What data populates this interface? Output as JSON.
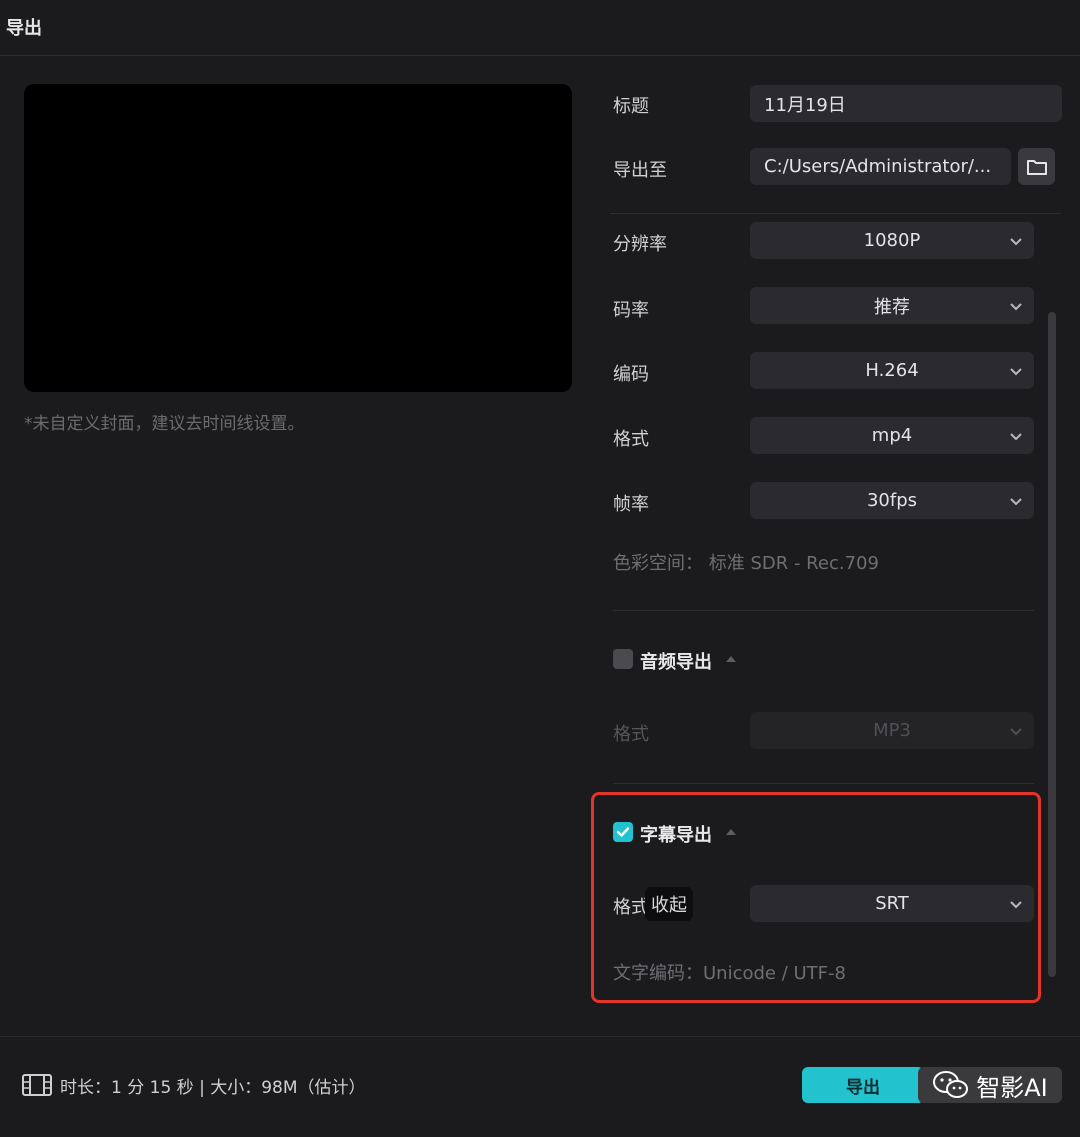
{
  "window": {
    "title": "导出"
  },
  "preview": {
    "note": "*未自定义封面，建议去时间线设置。"
  },
  "form": {
    "title_label": "标题",
    "title_value": "11月19日",
    "export_to_label": "导出至",
    "export_to_value": "C:/Users/Administrator/...",
    "resolution_label": "分辨率",
    "resolution_value": "1080P",
    "bitrate_label": "码率",
    "bitrate_value": "推荐",
    "codec_label": "编码",
    "codec_value": "H.264",
    "format_label": "格式",
    "format_value": "mp4",
    "fps_label": "帧率",
    "fps_value": "30fps",
    "color_space": "色彩空间：  标准 SDR - Rec.709"
  },
  "audio_export": {
    "title": "音频导出",
    "checked": false,
    "format_label": "格式",
    "format_value": "MP3"
  },
  "subtitle_export": {
    "title": "字幕导出",
    "checked": true,
    "format_label": "格式",
    "format_value": "SRT",
    "tooltip": "收起",
    "encoding": "文字编码：Unicode / UTF-8"
  },
  "footer": {
    "duration": "时长：1 分 15 秒 | 大小：98M（估计）",
    "export_button": "导出"
  },
  "watermark": {
    "text": "智影AI"
  },
  "colors": {
    "accent": "#22c3cf",
    "highlight": "#e3342a",
    "background": "#1b1b1d"
  }
}
